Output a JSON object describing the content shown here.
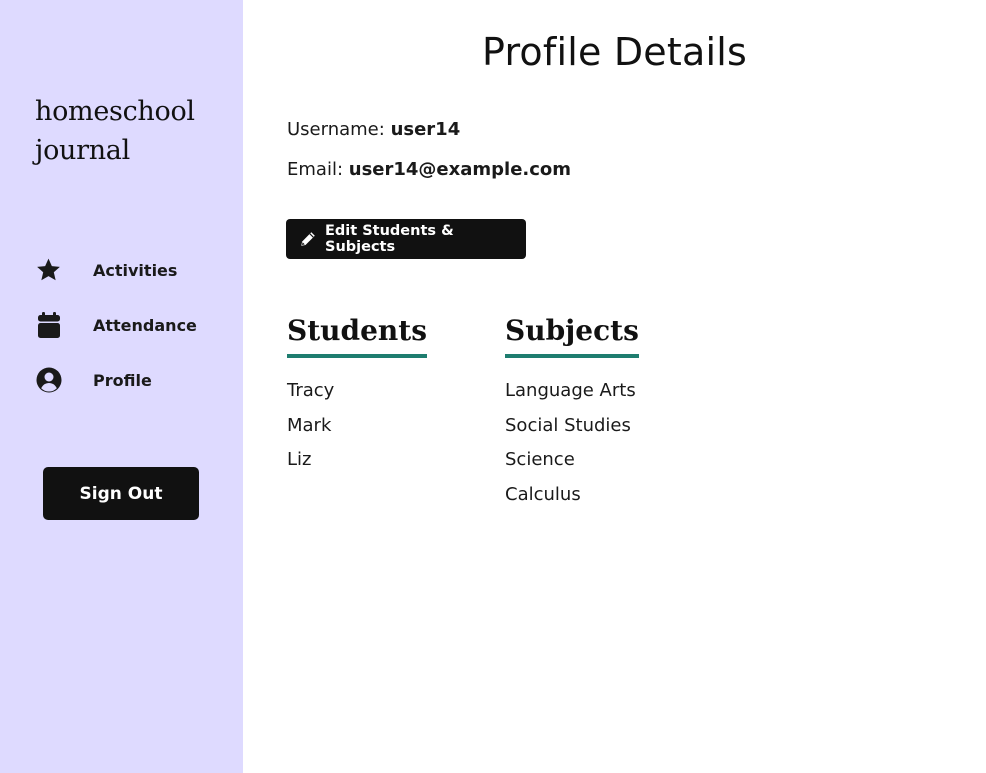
{
  "sidebar": {
    "brand_line1": "homeschool",
    "brand_line2": "journal",
    "nav": [
      {
        "label": "Activities",
        "icon": "star-icon"
      },
      {
        "label": "Attendance",
        "icon": "calendar-icon"
      },
      {
        "label": "Profile",
        "icon": "user-circle-icon"
      }
    ],
    "signout_label": "Sign Out"
  },
  "main": {
    "title": "Profile Details",
    "username_label": "Username:",
    "username_value": "user14",
    "email_label": "Email:",
    "email_value": "user14@example.com",
    "edit_button_label": "Edit Students & Subjects",
    "students_heading": "Students",
    "students": [
      "Tracy",
      "Mark",
      "Liz"
    ],
    "subjects_heading": "Subjects",
    "subjects": [
      "Language Arts",
      "Social Studies",
      "Science",
      "Calculus"
    ]
  },
  "colors": {
    "sidebar_bg": "#dedaff",
    "button_bg": "#111111",
    "heading_underline": "#1e7d6f"
  }
}
